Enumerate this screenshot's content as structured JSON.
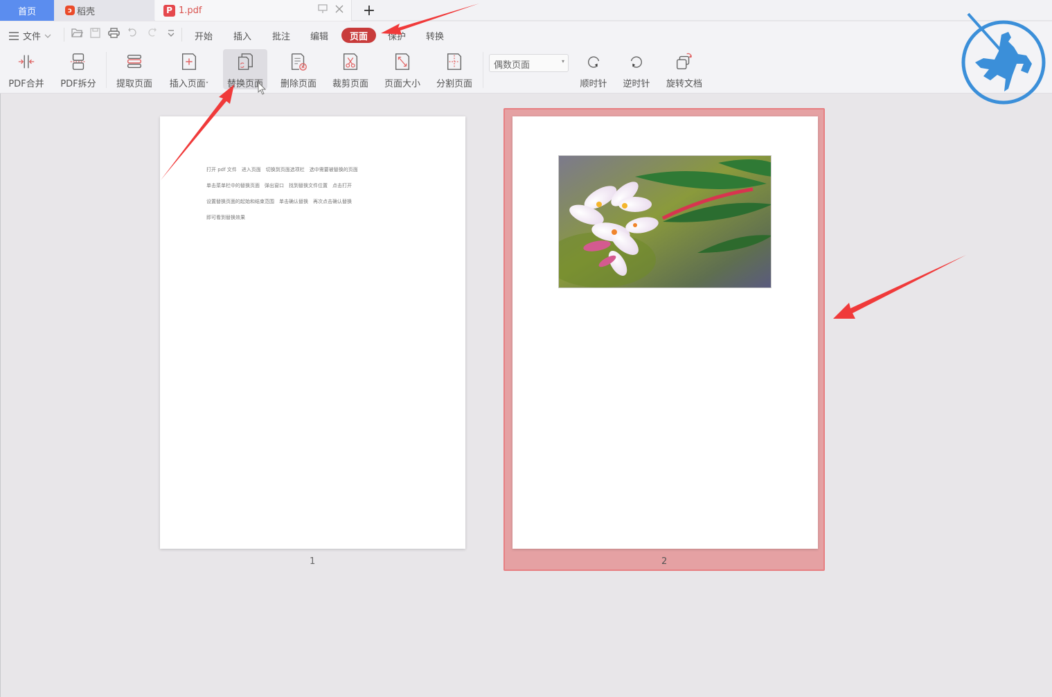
{
  "tabs": {
    "home": "首页",
    "daoke": "稻壳",
    "daoke_icon": "daoke-flame-icon",
    "document": "1.pdf",
    "document_icon": "pdf-icon",
    "add_label": "+"
  },
  "menu": {
    "file": "文件",
    "items": [
      "开始",
      "插入",
      "批注",
      "编辑",
      "页面",
      "保护",
      "转换"
    ],
    "active": "页面",
    "quick_access": [
      "open-icon",
      "save-icon",
      "print-icon",
      "undo-icon",
      "redo-icon",
      "more-icon"
    ]
  },
  "toolbar": {
    "tools": [
      {
        "label": "PDF合并",
        "icon": "merge-icon"
      },
      {
        "label": "PDF拆分",
        "icon": "split-icon"
      },
      {
        "label": "提取页面",
        "icon": "extract-pages-icon"
      },
      {
        "label": "插入页面",
        "icon": "insert-page-icon"
      },
      {
        "label": "替换页面",
        "icon": "replace-page-icon"
      },
      {
        "label": "删除页面",
        "icon": "delete-page-icon"
      },
      {
        "label": "裁剪页面",
        "icon": "crop-page-icon"
      },
      {
        "label": "页面大小",
        "icon": "page-size-icon"
      },
      {
        "label": "分割页面",
        "icon": "divide-page-icon"
      },
      {
        "label": "顺时针",
        "icon": "rotate-clockwise-icon"
      },
      {
        "label": "逆时针",
        "icon": "rotate-counterclockwise-icon"
      },
      {
        "label": "旋转文档",
        "icon": "rotate-document-icon"
      }
    ],
    "page_filter": "偶数页面"
  },
  "document": {
    "pages": [
      {
        "number": "1",
        "lines": [
          "打开 pdf 文件　进入页面　切换到页面选项栏　选中需要被替换的页面",
          "单击菜单栏中的替换页面　弹出窗口　找到替换文件位置　点击打开",
          "设置替换页面的起始和结束范围　单击确认替换　再次点击确认替换",
          "即可看到替换效果"
        ]
      },
      {
        "number": "2",
        "image": "plumeria flower photo",
        "selected": true
      }
    ]
  },
  "colors": {
    "accent_red": "#c83b3b",
    "home_tab_blue": "#5b8def",
    "selection_fill": "#e5a1a3",
    "logo_blue": "#3b8fd9",
    "annotation_arrow": "#f03a3a"
  }
}
